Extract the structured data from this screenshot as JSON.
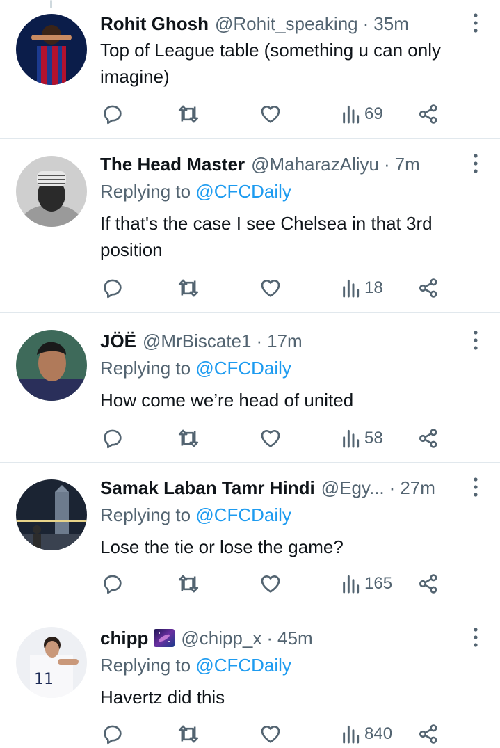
{
  "tweets": [
    {
      "name": "Rohit Ghosh",
      "handle": "@Rohit_speaking",
      "separator": "·",
      "time": "35m",
      "replying_prefix": "",
      "replying_to": "",
      "text": "Top of League table (something u can only imagine)",
      "views": "69",
      "avatar_colors": [
        "#0d2a6b",
        "#b3122e"
      ]
    },
    {
      "name": "The Head Master",
      "handle": "@MaharazAliyu",
      "separator": "·",
      "time": "7m",
      "replying_prefix": "Replying to ",
      "replying_to": "@CFCDaily",
      "text": "If that's the case I see Chelsea in that 3rd position",
      "views": "18",
      "avatar_colors": [
        "#d9d9d9",
        "#2b2b2b"
      ]
    },
    {
      "name": "JÖË",
      "handle": "@MrBiscate1",
      "separator": "·",
      "time": "17m",
      "replying_prefix": "Replying to ",
      "replying_to": "@CFCDaily",
      "text": "How come we’re head of united",
      "views": "58",
      "avatar_colors": [
        "#2f4a3c",
        "#8a4f3a"
      ]
    },
    {
      "name": "Samak Laban Tamr Hindi",
      "handle": "@Egy...",
      "separator": "·",
      "time": "27m",
      "replying_prefix": "Replying to ",
      "replying_to": "@CFCDaily",
      "text": "Lose the tie or lose the game?",
      "views": "165",
      "avatar_colors": [
        "#1e2a3a",
        "#6a7a8c"
      ]
    },
    {
      "name": "chipp",
      "handle": "@chipp_x",
      "separator": "·",
      "time": "45m",
      "replying_prefix": "Replying to ",
      "replying_to": "@CFCDaily",
      "text": "Havertz did this",
      "views": "840",
      "avatar_colors": [
        "#f0f0f5",
        "#1c2a55"
      ]
    }
  ],
  "colors": {
    "text": "#0f1419",
    "secondary": "#536471",
    "mention": "#1d9bf0",
    "divider": "#e1e8ed"
  },
  "icons": {
    "reply": "reply-icon",
    "retweet": "retweet-icon",
    "like": "like-icon",
    "views": "views-icon",
    "share": "share-icon",
    "more": "more-icon"
  }
}
